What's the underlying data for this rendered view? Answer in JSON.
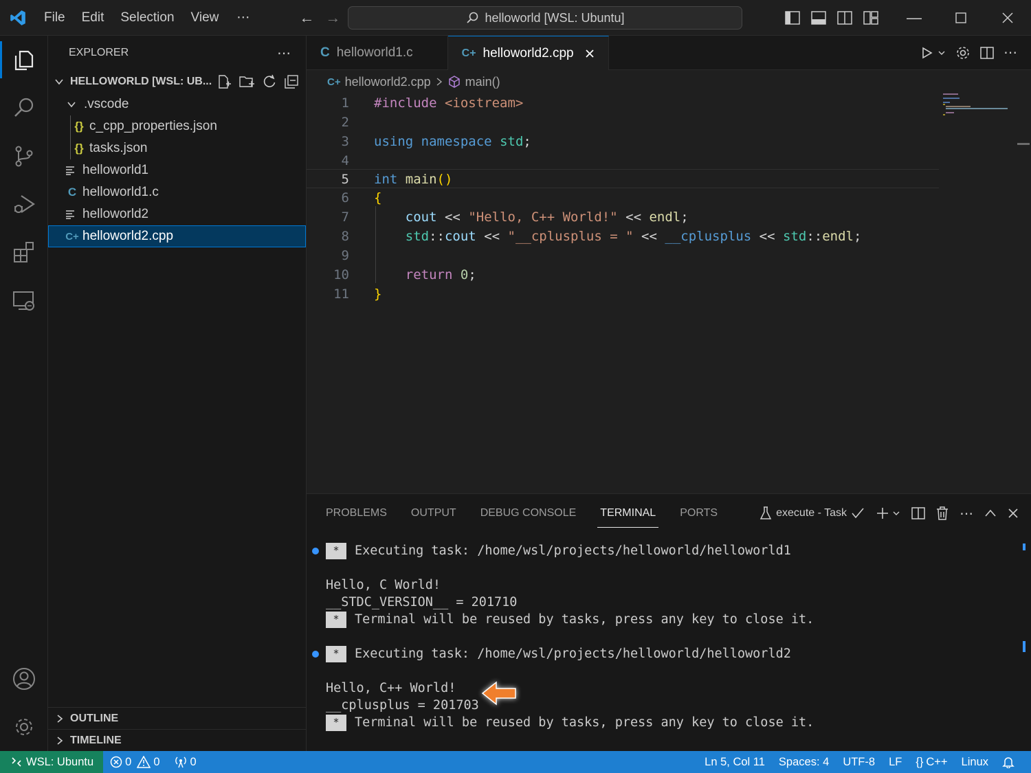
{
  "titlebar": {
    "menus": [
      "File",
      "Edit",
      "Selection",
      "View"
    ],
    "more": "⋯",
    "command_center": "helloworld [WSL: Ubuntu]"
  },
  "sidebar": {
    "header": "EXPLORER",
    "more": "⋯",
    "folder": "HELLOWORLD [WSL: UB...",
    "items": [
      {
        "label": ".vscode",
        "icon": "chevron-down-icon"
      },
      {
        "label": "c_cpp_properties.json",
        "icon": "json-icon"
      },
      {
        "label": "tasks.json",
        "icon": "json-icon"
      },
      {
        "label": "helloworld1",
        "icon": "binary-file-icon"
      },
      {
        "label": "helloworld1.c",
        "icon": "c-file-icon"
      },
      {
        "label": "helloworld2",
        "icon": "binary-file-icon"
      },
      {
        "label": "helloworld2.cpp",
        "icon": "cpp-file-icon"
      }
    ],
    "sections": [
      "OUTLINE",
      "TIMELINE"
    ]
  },
  "tabs": [
    {
      "label": "helloworld1.c",
      "active": false
    },
    {
      "label": "helloworld2.cpp",
      "active": true
    }
  ],
  "breadcrumb": {
    "file": "helloworld2.cpp",
    "symbol": "main()"
  },
  "editor": {
    "line_numbers": [
      "1",
      "2",
      "3",
      "4",
      "5",
      "6",
      "7",
      "8",
      "9",
      "10",
      "11"
    ],
    "current_line": 5
  },
  "panel": {
    "tabs": [
      "PROBLEMS",
      "OUTPUT",
      "DEBUG CONSOLE",
      "TERMINAL",
      "PORTS"
    ],
    "active_tab": "TERMINAL",
    "task_label": "execute - Task",
    "terminal": {
      "exec1": "Executing task: /home/wsl/projects/helloworld/helloworld1",
      "out1a": "Hello, C World!",
      "out1b": "__STDC_VERSION__ = 201710",
      "reuse1": "Terminal will be reused by tasks, press any key to close it.",
      "exec2": "Executing task: /home/wsl/projects/helloworld/helloworld2",
      "out2a": "Hello, C++ World!",
      "out2b": "__cplusplus = 201703",
      "reuse2": "Terminal will be reused by tasks, press any key to close it.",
      "star": "*"
    }
  },
  "statusbar": {
    "remote": "WSL: Ubuntu",
    "errors": "0",
    "warnings": "0",
    "ports": "0",
    "position": "Ln 5, Col 11",
    "spaces": "Spaces: 4",
    "encoding": "UTF-8",
    "eol": "LF",
    "language": "C++",
    "config": "Linux"
  },
  "colors": {
    "accent": "#0078d4",
    "statusbar": "#1e7fd1",
    "remote": "#16825d",
    "annotation_arrow": "#f07f2d"
  }
}
